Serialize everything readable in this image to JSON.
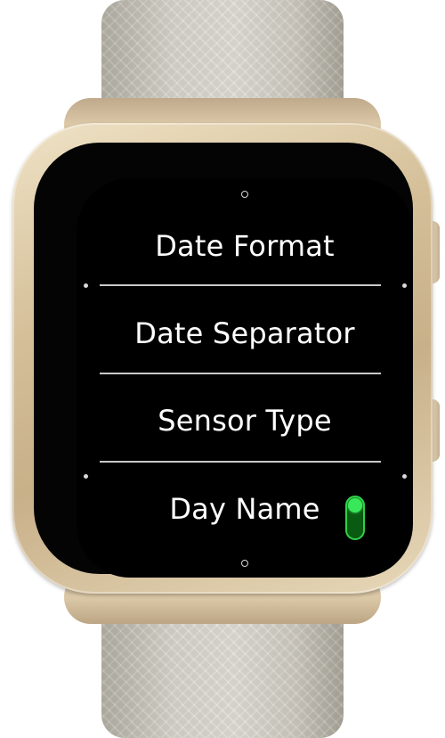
{
  "watch": {
    "case_color": "#d4bf98",
    "band_color": "#d9d6cd",
    "screen_color": "#000000",
    "accent_color": "#39e85a"
  },
  "menu": {
    "items": [
      {
        "label": "Date Format"
      },
      {
        "label": "Date Separator"
      },
      {
        "label": "Sensor Type"
      },
      {
        "label": "Day Name",
        "toggle": {
          "state": "on"
        }
      }
    ]
  }
}
